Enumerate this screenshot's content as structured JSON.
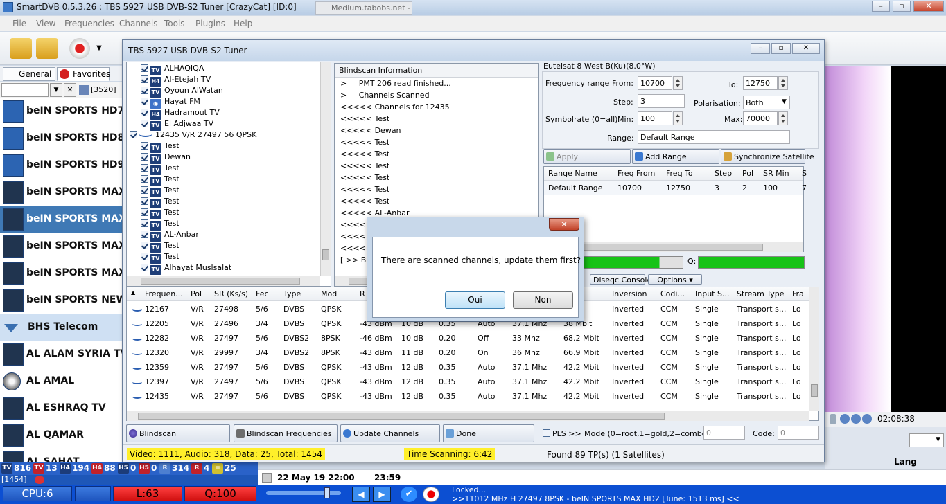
{
  "app": {
    "title": "SmartDVB 0.5.3.26 : TBS 5927 USB DVB-S2 Tuner [CrazyCat] [ID:0]",
    "bg_tab": "Medium.tabobs.net - Save Torr..."
  },
  "menu": [
    "File",
    "View",
    "Frequencies",
    "Channels",
    "Tools",
    "Plugins",
    "Help"
  ],
  "left_tabs": {
    "general": "General",
    "favorites": "Favorites"
  },
  "filter": {
    "tp_label": "[3520]",
    "close": "✕"
  },
  "channels": [
    {
      "name": "beIN SPORTS HD7",
      "icon": "hd264-icon",
      "selected": false
    },
    {
      "name": "beIN SPORTS HD8",
      "icon": "hd264-icon",
      "selected": false
    },
    {
      "name": "beIN SPORTS HD9",
      "icon": "hd264-icon",
      "selected": false
    },
    {
      "name": "beIN SPORTS MAX HD",
      "icon": "film264-icon",
      "selected": false
    },
    {
      "name": "beIN SPORTS MAX HD",
      "icon": "film264-icon",
      "selected": true
    },
    {
      "name": "beIN SPORTS MAX HD",
      "icon": "film264-icon",
      "selected": false
    },
    {
      "name": "beIN SPORTS MAX HD",
      "icon": "film264-icon",
      "selected": false
    },
    {
      "name": "beIN SPORTS NEWS HD",
      "icon": "film264-icon",
      "selected": false
    },
    {
      "name": "BHS Telecom",
      "icon": "group-triangle-icon",
      "group": true
    },
    {
      "name": "AL ALAM SYRIA TV",
      "icon": "film-icon"
    },
    {
      "name": "AL AMAL",
      "icon": "disc-icon"
    },
    {
      "name": "AL ESHRAQ TV",
      "icon": "film-icon"
    },
    {
      "name": "AL QAMAR",
      "icon": "film-icon"
    },
    {
      "name": "AL SAHAT",
      "icon": "film-icon"
    }
  ],
  "counts": {
    "line1": [
      {
        "badge": "TV",
        "value": "816",
        "color": "#1c3c7a"
      },
      {
        "badge": "TV",
        "value": "13",
        "color": "#c0222a"
      },
      {
        "badge": "H4",
        "value": "194",
        "color": "#1c3c7a"
      },
      {
        "badge": "H4",
        "value": "88",
        "color": "#c0222a"
      },
      {
        "badge": "H5",
        "value": "0",
        "color": "#1c3c7a"
      },
      {
        "badge": "H5",
        "value": "0",
        "color": "#c0222a"
      },
      {
        "badge": "R",
        "value": "314",
        "color": "#4d7fd0"
      },
      {
        "badge": "R",
        "value": "4",
        "color": "#c0222a"
      },
      {
        "badge": "=",
        "value": "25",
        "color": "#d0c030"
      }
    ],
    "line2": "[1454]"
  },
  "status": {
    "cpu": "CPU:6",
    "level": "L:63",
    "quality": "Q:100",
    "locked": "Locked...",
    "tune_info": ">>11012 MHz H 27497 8PSK - beIN SPORTS MAX HD2 [Tune: 1513 ms] <<",
    "time": "02:08:38",
    "lang": "Lang"
  },
  "epg": {
    "date": "22 May 19 22:00",
    "end": "23:59"
  },
  "tuner": {
    "title": "TBS 5927 USB DVB-S2 Tuner",
    "tree": [
      {
        "text": "ALHAQIQA",
        "badge": "TV",
        "indent": 1
      },
      {
        "text": "Al-Etejah TV",
        "badge": "H4",
        "indent": 1
      },
      {
        "text": "Oyoun AlWatan",
        "badge": "TV",
        "indent": 1
      },
      {
        "text": "Hayat FM",
        "badge": "R",
        "indent": 1
      },
      {
        "text": "Hadramout TV",
        "badge": "H4",
        "indent": 1
      },
      {
        "text": "El Adjwaa TV",
        "badge": "TV",
        "indent": 1
      },
      {
        "text": "12435 V/R 27497 56 QPSK",
        "badge": "wave",
        "indent": 0
      },
      {
        "text": "Test",
        "badge": "TV",
        "indent": 1
      },
      {
        "text": "Dewan",
        "badge": "TV",
        "indent": 1
      },
      {
        "text": "Test",
        "badge": "TV",
        "indent": 1
      },
      {
        "text": "Test",
        "badge": "TV",
        "indent": 1
      },
      {
        "text": "Test",
        "badge": "TV",
        "indent": 1
      },
      {
        "text": "Test",
        "badge": "TV",
        "indent": 1
      },
      {
        "text": "Test",
        "badge": "TV",
        "indent": 1
      },
      {
        "text": "Test",
        "badge": "TV",
        "indent": 1
      },
      {
        "text": "AL-Anbar",
        "badge": "TV",
        "indent": 1
      },
      {
        "text": "Test",
        "badge": "TV",
        "indent": 1
      },
      {
        "text": "Test",
        "badge": "TV",
        "indent": 1
      },
      {
        "text": "Alhayat Muslsalat",
        "badge": "TV",
        "indent": 1
      }
    ],
    "log_title": "Blindscan Information",
    "log": [
      ">     PMT 206 read finished...",
      ">     Channels Scanned",
      "<<<<< Channels for 12435",
      "<<<<< Test",
      "<<<<< Dewan",
      "<<<<< Test",
      "<<<<< Test",
      "<<<<< Test",
      "<<<<< Test",
      "<<<<< Test",
      "<<<<< Test",
      "<<<<< AL-Anbar",
      "<<<<<",
      "<<<<<",
      "<<<<<",
      "[ >> Blin"
    ],
    "satellite": "Eutelsat 8 West B(Ku)(8.0°W)",
    "labels": {
      "freq_range": "Frequency range",
      "from": "From:",
      "to": "To:",
      "step": "Step:",
      "polarisation": "Polarisation:",
      "symbolrate": "Symbolrate (0=all)",
      "min": "Min:",
      "max": "Max:",
      "range": "Range:"
    },
    "values": {
      "from": "10700",
      "to": "12750",
      "step": "3",
      "polarisation": "Both",
      "min": "100",
      "max": "70000",
      "range": "Default Range"
    },
    "buttons": {
      "apply": "Apply",
      "add_range": "Add Range",
      "sync": "Synchronize Satellite",
      "diseqc": "Diseqc Console",
      "options": "Options",
      "blindscan": "Blindscan",
      "bs_freq": "Blindscan Frequencies",
      "update": "Update Channels",
      "done": "Done"
    },
    "range_headers": [
      "Range Name",
      "Freq From",
      "Freq To",
      "Step",
      "Pol",
      "SR Min",
      "S"
    ],
    "range_rows": [
      [
        "Default Range",
        "10700",
        "12750",
        "3",
        "2",
        "100",
        "7"
      ]
    ],
    "q_label": "Q:",
    "tp_headers": [
      "Frequen...",
      "Pol",
      "SR (Ks/s)",
      "Fec",
      "Type",
      "Mod",
      "R",
      "",
      "",
      "",
      "",
      "",
      "Inversion",
      "Codi...",
      "Input S...",
      "Stream Type",
      "Fra"
    ],
    "tp_rows": [
      [
        "12167",
        "V/R",
        "27498",
        "5/6",
        "DVBS",
        "QPSK",
        "",
        "",
        "",
        "",
        "",
        "Mbit",
        "Inverted",
        "CCM",
        "Single",
        "Transport s...",
        "Lo"
      ],
      [
        "12205",
        "V/R",
        "27496",
        "3/4",
        "DVBS",
        "QPSK",
        "-43 dBm",
        "10 dB",
        "0.35",
        "Auto",
        "37.1 Mhz",
        "38 Mbit",
        "Inverted",
        "CCM",
        "Single",
        "Transport s...",
        "Lo"
      ],
      [
        "12282",
        "V/R",
        "27497",
        "5/6",
        "DVBS2",
        "8PSK",
        "-46 dBm",
        "10 dB",
        "0.20",
        "Off",
        "33 Mhz",
        "68.2 Mbit",
        "Inverted",
        "CCM",
        "Single",
        "Transport s...",
        "Lo"
      ],
      [
        "12320",
        "V/R",
        "29997",
        "3/4",
        "DVBS2",
        "8PSK",
        "-43 dBm",
        "11 dB",
        "0.20",
        "On",
        "36 Mhz",
        "66.9 Mbit",
        "Inverted",
        "CCM",
        "Single",
        "Transport s...",
        "Lo"
      ],
      [
        "12359",
        "V/R",
        "27497",
        "5/6",
        "DVBS",
        "QPSK",
        "-43 dBm",
        "12 dB",
        "0.35",
        "Auto",
        "37.1 Mhz",
        "42.2 Mbit",
        "Inverted",
        "CCM",
        "Single",
        "Transport s...",
        "Lo"
      ],
      [
        "12397",
        "V/R",
        "27497",
        "5/6",
        "DVBS",
        "QPSK",
        "-43 dBm",
        "12 dB",
        "0.35",
        "Auto",
        "37.1 Mhz",
        "42.2 Mbit",
        "Inverted",
        "CCM",
        "Single",
        "Transport s...",
        "Lo"
      ],
      [
        "12435",
        "V/R",
        "27497",
        "5/6",
        "DVBS",
        "QPSK",
        "-43 dBm",
        "12 dB",
        "0.35",
        "Auto",
        "37.1 Mhz",
        "42.2 Mbit",
        "Inverted",
        "CCM",
        "Single",
        "Transport s...",
        "Lo"
      ]
    ],
    "pls": "PLS >>",
    "mode": "Mode (0=root,1=gold,2=combo):",
    "mode_val": "0",
    "code": "Code:",
    "code_val": "0",
    "summary": "Video: 1111, Audio: 318, Data: 25, Total: 1454",
    "time_scanning": "Time Scanning: 6:42",
    "found": "Found 89 TP(s) (1 Satellites)"
  },
  "question": {
    "text": "There are scanned channels, update them first?",
    "yes": "Oui",
    "no": "Non",
    "close": "✕"
  }
}
